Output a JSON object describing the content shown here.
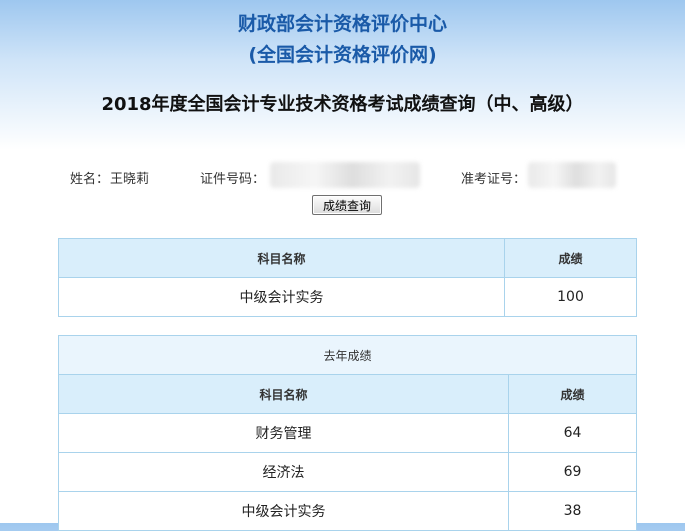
{
  "header": {
    "org_line1": "财政部会计资格评价中心",
    "org_line2": "(全国会计资格评价网)",
    "title": "2018年度全国会计专业技术资格考试成绩查询（中、高级）"
  },
  "info": {
    "name_label": "姓名：",
    "name_value": "王晓莉",
    "id_label": "证件号码：",
    "ticket_label": "准考证号："
  },
  "query_button": "成绩查询",
  "current_scores": {
    "headers": [
      "科目名称",
      "成绩"
    ],
    "rows": [
      {
        "subject": "中级会计实务",
        "score": "100"
      }
    ]
  },
  "last_year": {
    "caption": "去年成绩",
    "headers": [
      "科目名称",
      "成绩"
    ],
    "rows": [
      {
        "subject": "财务管理",
        "score": "64"
      },
      {
        "subject": "经济法",
        "score": "69"
      },
      {
        "subject": "中级会计实务",
        "score": "38"
      }
    ]
  }
}
